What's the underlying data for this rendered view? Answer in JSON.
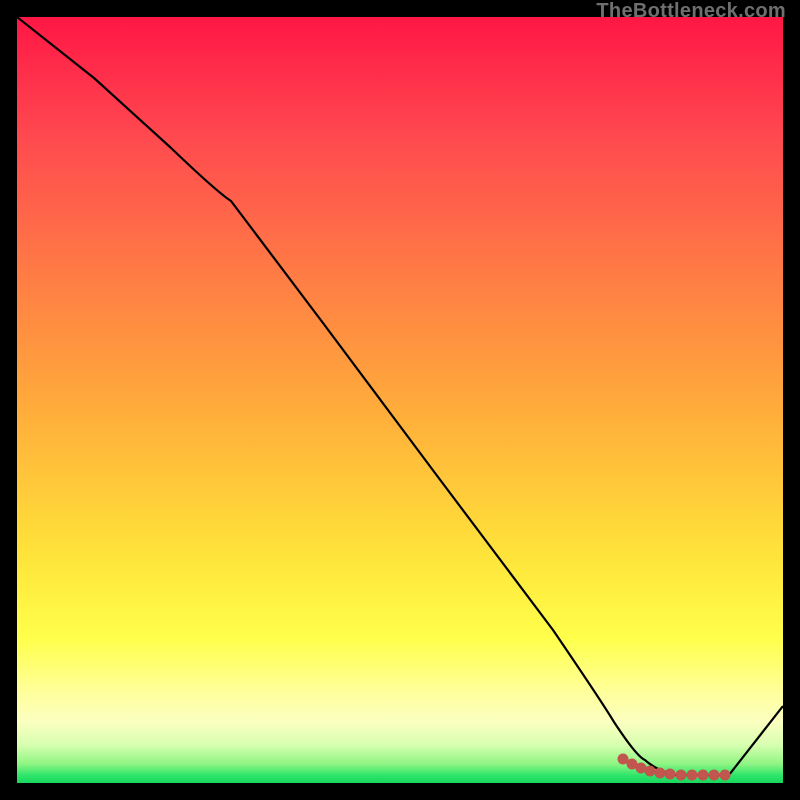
{
  "watermark": "TheBottleneck.com",
  "chart_data": {
    "type": "line",
    "title": "",
    "xlabel": "",
    "ylabel": "",
    "xlim": [
      0,
      100
    ],
    "ylim": [
      0,
      100
    ],
    "series": [
      {
        "name": "curve",
        "x": [
          0,
          10,
          20,
          28,
          40,
          55,
          70,
          78,
          82,
          86,
          90,
          93,
          100
        ],
        "y": [
          100,
          92,
          83,
          76,
          60,
          40,
          20,
          8,
          3,
          1,
          1,
          1,
          10
        ]
      }
    ],
    "markers": {
      "name": "highlight-segment",
      "color": "#c1564e",
      "x": [
        78,
        80,
        82,
        84,
        86,
        88,
        90,
        92
      ],
      "y": [
        3.0,
        2.2,
        1.6,
        1.2,
        1.0,
        1.0,
        1.0,
        1.0
      ]
    },
    "background_gradient": {
      "top": "#ff1744",
      "middle": "#ffde3a",
      "bottom": "#17d65e"
    }
  }
}
